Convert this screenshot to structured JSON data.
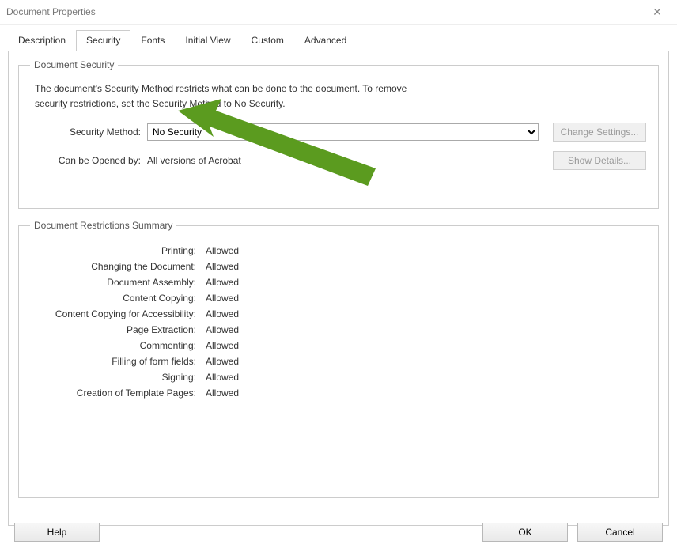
{
  "window": {
    "title": "Document Properties",
    "close_tooltip": "Close"
  },
  "tabs": {
    "items": [
      {
        "label": "Description"
      },
      {
        "label": "Security"
      },
      {
        "label": "Fonts"
      },
      {
        "label": "Initial View"
      },
      {
        "label": "Custom"
      },
      {
        "label": "Advanced"
      }
    ],
    "active_index": 1
  },
  "security_group": {
    "legend": "Document Security",
    "description_line1": "The document's Security Method restricts what can be done to the document. To remove",
    "description_line2": "security restrictions, set the Security Method to No Security.",
    "method_label": "Security Method:",
    "method_value": "No Security",
    "change_settings_label": "Change Settings...",
    "opened_by_label": "Can be Opened by:",
    "opened_by_value": "All versions of Acrobat",
    "show_details_label": "Show Details..."
  },
  "restrictions_group": {
    "legend": "Document Restrictions Summary",
    "rows": [
      {
        "label": "Printing:",
        "value": "Allowed"
      },
      {
        "label": "Changing the Document:",
        "value": "Allowed"
      },
      {
        "label": "Document Assembly:",
        "value": "Allowed"
      },
      {
        "label": "Content Copying:",
        "value": "Allowed"
      },
      {
        "label": "Content Copying for Accessibility:",
        "value": "Allowed"
      },
      {
        "label": "Page Extraction:",
        "value": "Allowed"
      },
      {
        "label": "Commenting:",
        "value": "Allowed"
      },
      {
        "label": "Filling of form fields:",
        "value": "Allowed"
      },
      {
        "label": "Signing:",
        "value": "Allowed"
      },
      {
        "label": "Creation of Template Pages:",
        "value": "Allowed"
      }
    ]
  },
  "footer": {
    "help_label": "Help",
    "ok_label": "OK",
    "cancel_label": "Cancel"
  }
}
